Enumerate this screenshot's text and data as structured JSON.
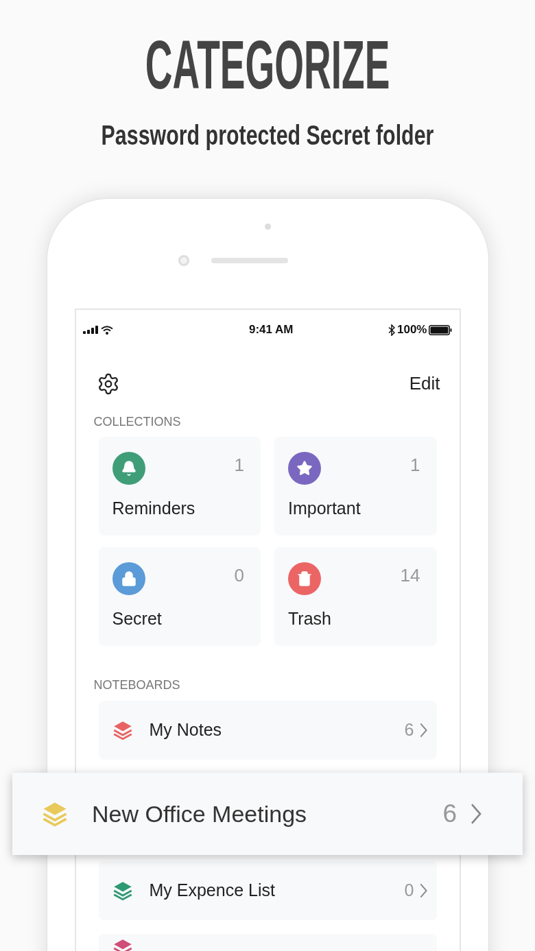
{
  "headline": "CATEGORIZE",
  "subtitle": "Password protected Secret folder",
  "status_bar": {
    "time": "9:41 AM",
    "battery": "100%"
  },
  "toolbar": {
    "edit": "Edit"
  },
  "collections": {
    "label": "COLLECTIONS",
    "items": [
      {
        "kind": "bell",
        "name": "Reminders",
        "count": "1",
        "color": "#3f9e78"
      },
      {
        "kind": "star",
        "name": "Important",
        "count": "1",
        "color": "#7a68c0"
      },
      {
        "kind": "lock",
        "name": "Secret",
        "count": "0",
        "color": "#5b9bd8"
      },
      {
        "kind": "trash",
        "name": "Trash",
        "count": "14",
        "color": "#ec6565"
      }
    ]
  },
  "noteboards": {
    "label": "NOTEBOARDS",
    "items": [
      {
        "name": "My Notes",
        "count": "6",
        "color": "#e86464"
      },
      {
        "kind": "lifted"
      },
      {
        "name": "My Expence List",
        "count": "0",
        "color": "#2f9a72"
      },
      {
        "color": "#cf4f78"
      }
    ]
  },
  "lifted_row": {
    "name": "New Office Meetings",
    "count": "6",
    "color": "#e8c95a"
  }
}
